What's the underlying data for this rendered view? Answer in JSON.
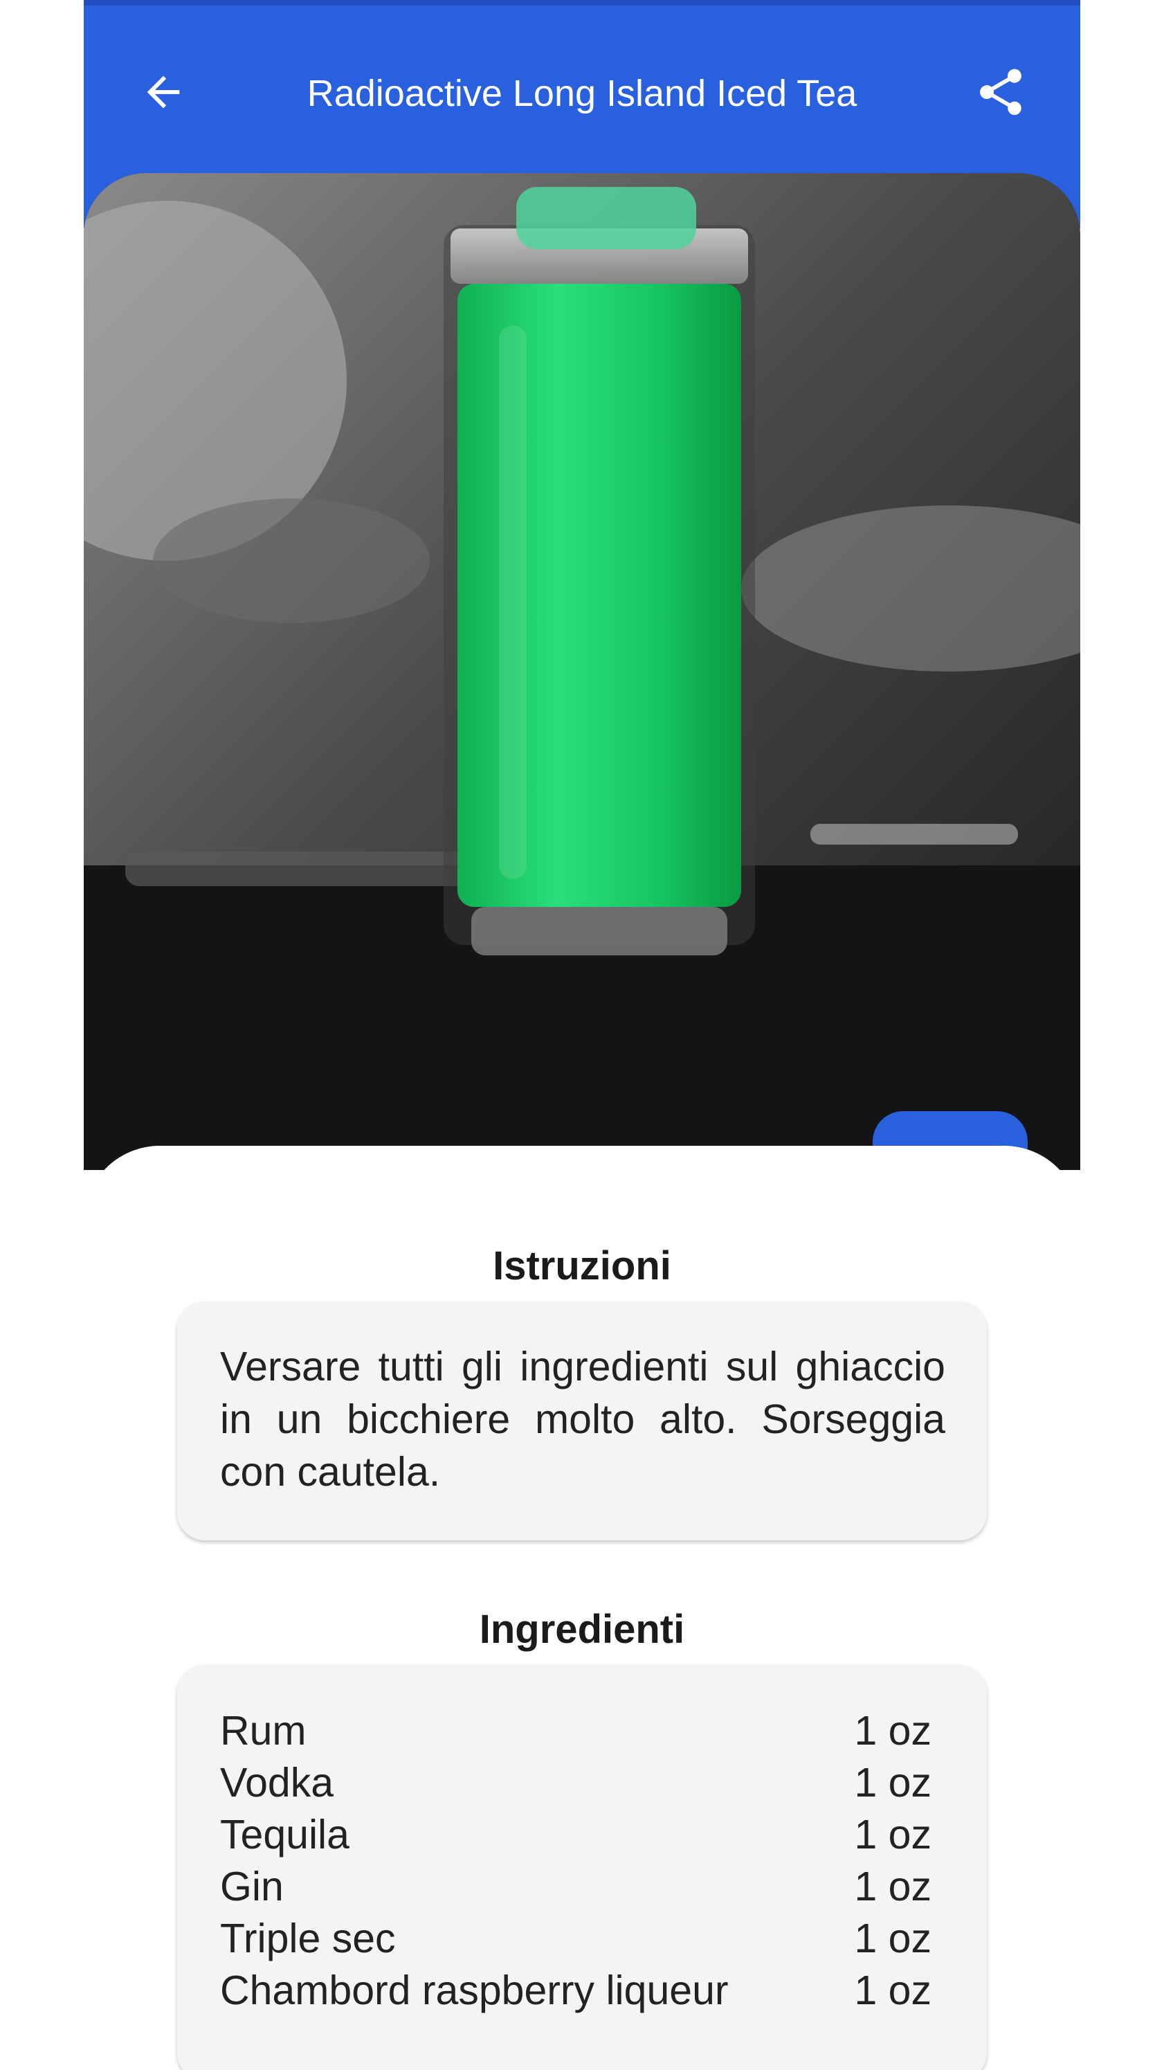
{
  "appbar": {
    "title": "Radioactive Long Island Iced Tea",
    "back_icon": "arrow-left-icon",
    "share_icon": "share-icon",
    "color": "#2960DE"
  },
  "hero": {
    "favorite_icon": "star-outline-icon",
    "favorite_color": "#F2B51B"
  },
  "instructions": {
    "heading": "Istruzioni",
    "text": "Versare tutti gli ingredienti sul ghiaccio in un bicchiere molto alto. Sorseggia con cautela."
  },
  "ingredients": {
    "heading": "Ingredienti",
    "items": [
      {
        "name": "Rum",
        "qty": "1 oz"
      },
      {
        "name": "Vodka",
        "qty": "1 oz"
      },
      {
        "name": "Tequila",
        "qty": "1 oz"
      },
      {
        "name": "Gin",
        "qty": "1 oz"
      },
      {
        "name": "Triple sec",
        "qty": "1 oz"
      },
      {
        "name": "Chambord raspberry liqueur",
        "qty": "1 oz"
      }
    ]
  }
}
